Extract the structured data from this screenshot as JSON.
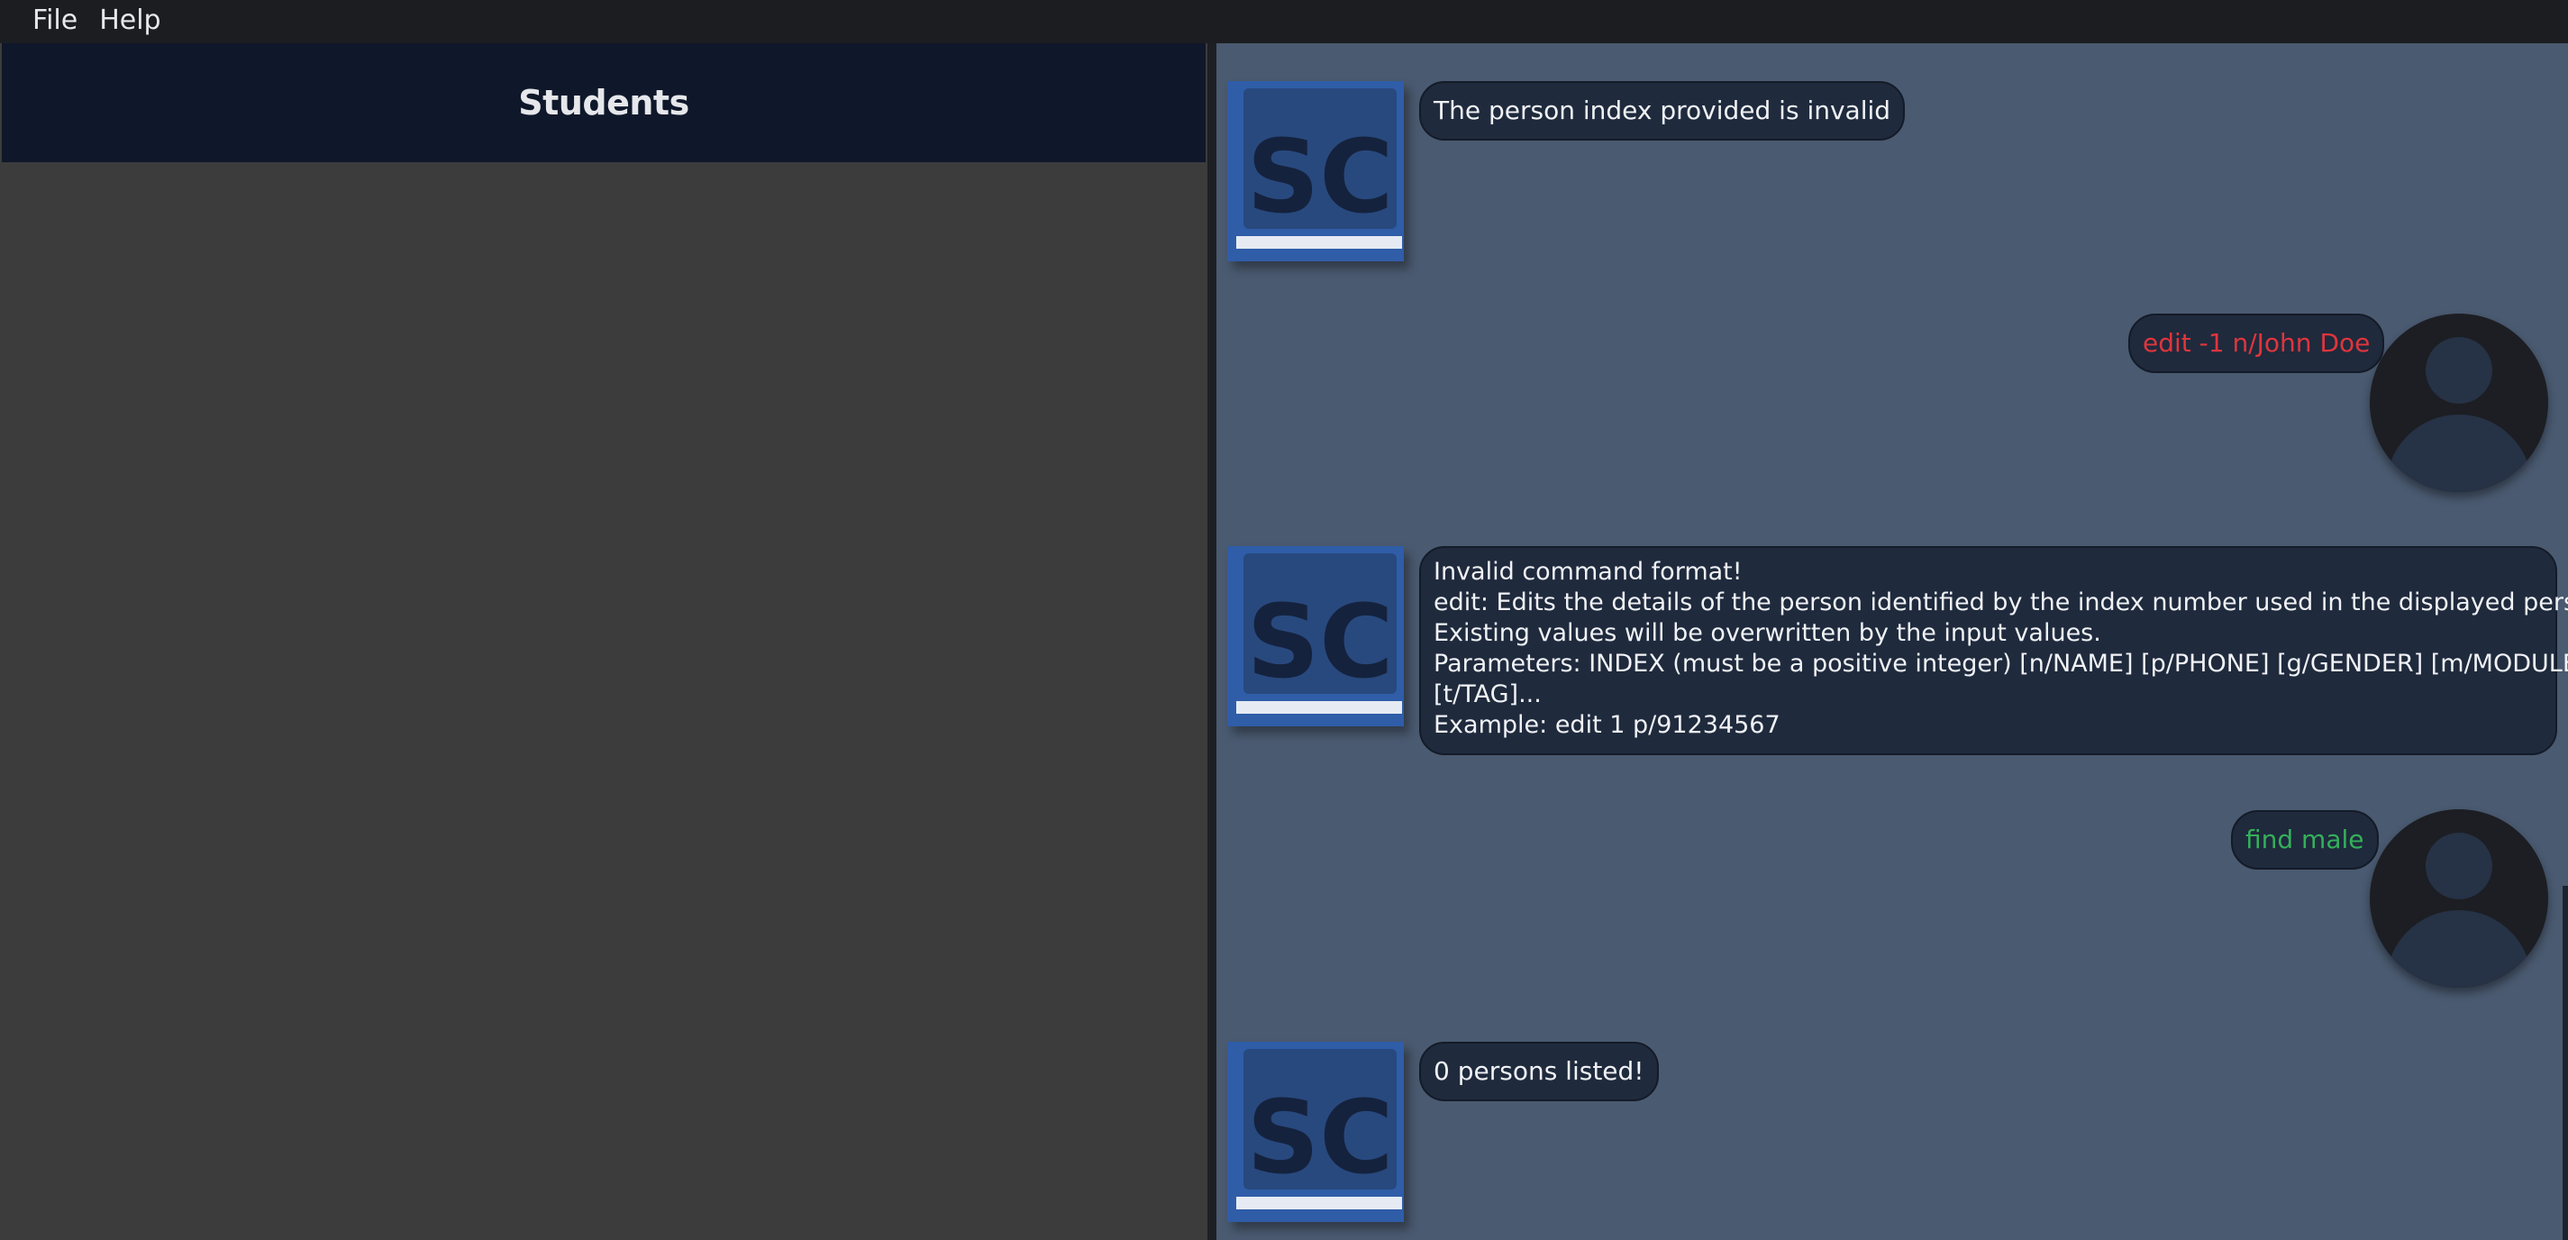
{
  "menu": {
    "file_label": "File",
    "help_label": "Help"
  },
  "left_panel": {
    "title": "Students"
  },
  "chat": {
    "messages": [
      {
        "from": "bot",
        "avatar_text": "SC",
        "text": "The person index provided is invalid"
      },
      {
        "from": "user",
        "text": "edit -1 n/John Doe",
        "color": "#e0353c"
      },
      {
        "from": "bot",
        "avatar_text": "SC",
        "lines": [
          "Invalid command format!",
          "edit: Edits the details of the person identified by the index number used in the displayed person list.",
          "Existing values will be overwritten by the input values.",
          "Parameters: INDEX (must be a positive integer) [n/NAME] [p/PHONE] [g/GENDER] [m/MODULE]",
          "[t/TAG]...",
          "Example: edit 1 p/91234567"
        ]
      },
      {
        "from": "user",
        "text": "find male",
        "color": "#34b05a"
      },
      {
        "from": "bot",
        "avatar_text": "SC",
        "text": "0 persons listed!"
      }
    ]
  },
  "colors": {
    "chat_background": "#4a5a70",
    "bubble_background": "#1f2a3d",
    "header_background": "#0f172a",
    "list_background": "#3c3c3c",
    "bot_avatar": "#2f5da8"
  },
  "icons": {
    "bot_avatar": "sc-logo-icon",
    "user_avatar": "user-silhouette-icon"
  }
}
